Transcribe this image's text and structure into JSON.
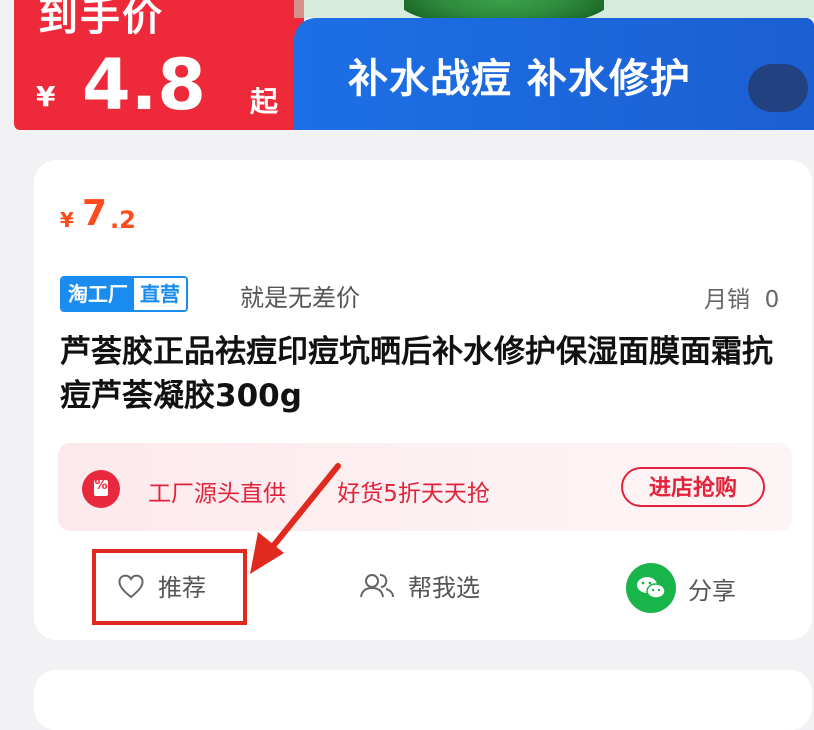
{
  "banner": {
    "top_text": "到手价",
    "currency": "¥",
    "price": "4.8",
    "price_suffix": "起",
    "slogan": "补水战痘 补水修护"
  },
  "product": {
    "currency": "¥",
    "price_int": "7",
    "price_dec": ".2",
    "badge_left": "淘工厂",
    "badge_right": "直营",
    "subtitle": "就是无差价",
    "sales_label": "月销",
    "sales_value": "0",
    "title": "芦荟胶正品祛痘印痘坑晒后补水修护保湿面膜面霜抗痘芦荟凝胶300g"
  },
  "promo": {
    "icon_text": "%",
    "text_1": "工厂源头直供",
    "text_2": "好货5折天天抢",
    "button_label": "进店抢购"
  },
  "actions": {
    "recommend_label": "推荐",
    "help_choose_label": "帮我选",
    "share_label": "分享"
  },
  "icons": {
    "heart": "heart-icon",
    "users": "users-icon",
    "wechat": "wechat-icon",
    "discount": "discount-icon"
  },
  "colors": {
    "price_orange": "#ff4a1b",
    "promo_red": "#e2233a",
    "annotation_red": "#e02a1f",
    "badge_blue": "#1a8cf0"
  }
}
